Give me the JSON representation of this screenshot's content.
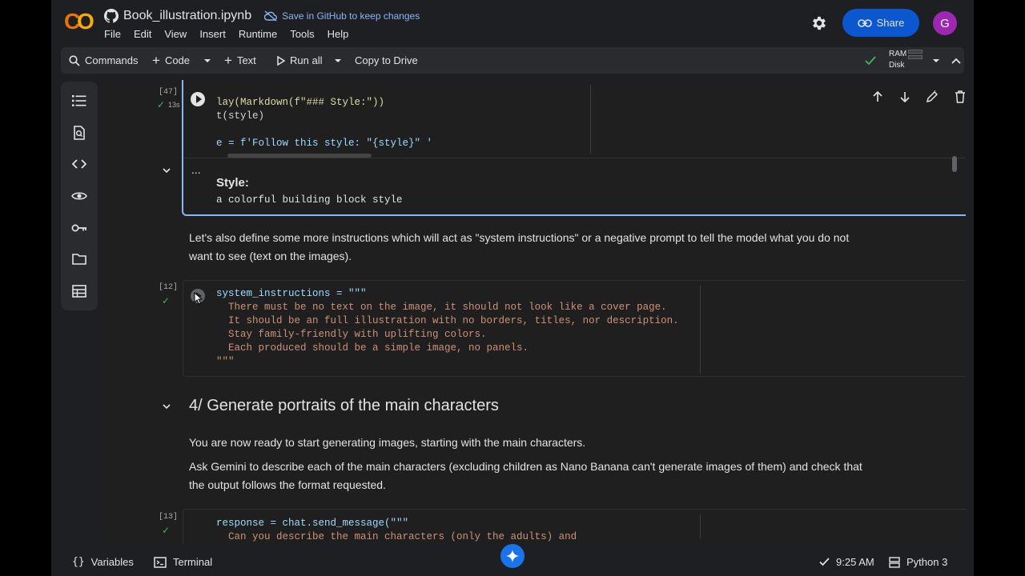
{
  "header": {
    "notebook_title": "Book_illustration.ipynb",
    "save_github": "Save in GitHub to keep changes",
    "share_label": "Share",
    "avatar_letter": "G",
    "menus": [
      "File",
      "Edit",
      "View",
      "Insert",
      "Runtime",
      "Tools",
      "Help"
    ]
  },
  "toolbar": {
    "commands": "Commands",
    "code": "Code",
    "text": "Text",
    "run_all": "Run all",
    "copy_drive": "Copy to Drive",
    "ram": "RAM",
    "disk": "Disk"
  },
  "cell47": {
    "exec": "[47]",
    "time": "13s",
    "line1a": "lay(Markdown(f\"### Style:\"))",
    "line2": "t(style)",
    "line4": "e = f'Follow this style: \"{style}\" '",
    "output_more": "...",
    "output_heading": "Style:",
    "output_text": "a colorful building block style"
  },
  "markdown1": {
    "line1": "Let's also define some more instructions which will act as \"system instructions\" or a negative prompt to tell the model what you do not",
    "line2": "want to see (text on the images)."
  },
  "cell12": {
    "exec": "[12]",
    "line1": "system_instructions = \"\"\"",
    "line2": "  There must be no text on the image, it should not look like a cover page.",
    "line3": "  It should be an full illustration with no borders, titles, nor description.",
    "line4": "  Stay family-friendly with uplifting colors.",
    "line5": "  Each produced should be a simple image, no panels.",
    "line6": "\"\"\""
  },
  "section4": {
    "heading": "4/ Generate portraits of the main characters",
    "para1": "You are now ready to start generating images, starting with the main characters.",
    "para2a": "Ask Gemini to describe each of the main characters (excluding children as Nano Banana can't generate images of them) and check that",
    "para2b": "the output follows the format requested."
  },
  "cell13": {
    "exec": "[13]",
    "line1": "response = chat.send_message(\"\"\"",
    "line2": "  Can you describe the main characters (only the adults) and"
  },
  "statusbar": {
    "variables": "Variables",
    "terminal": "Terminal",
    "time": "9:25 AM",
    "kernel": "Python 3"
  },
  "colors": {
    "accent": "#0b57d0",
    "focus_border": "#8ab4f8",
    "check": "#3cba54",
    "string": "#ce9178",
    "logo_orange": "#f9ab00",
    "logo_dark_orange": "#e8710a"
  }
}
